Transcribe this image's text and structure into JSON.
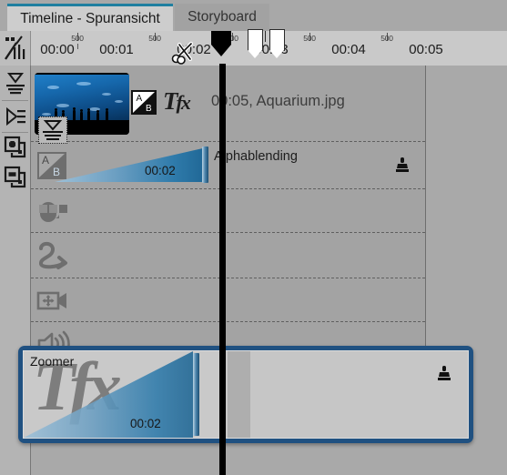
{
  "window": {
    "app_kind": "video-editing-timeline",
    "accent_color": "#1f7fa0",
    "selection_border_color": "#205181",
    "background_color": "#a9a9a9"
  },
  "tabs": [
    {
      "label": "Timeline - Spuransicht",
      "active": true
    },
    {
      "label": "Storyboard",
      "active": false
    }
  ],
  "ruler": {
    "icon": "timeline-scale-icon",
    "major_labels": [
      "00:00",
      "00:01",
      "00:02",
      "00:03",
      "00:04",
      "00:05"
    ],
    "minor_labels": [
      "500",
      "500",
      "500",
      "500",
      "500"
    ],
    "markers": [
      {
        "name": "in-marker",
        "position_label": "00:03"
      },
      {
        "name": "out-marker",
        "position_label": "00:03"
      }
    ],
    "playhead_time": "00:02"
  },
  "toolbar": {
    "buttons": [
      {
        "name": "align-down-button",
        "icon": "align-collapse-icon"
      },
      {
        "name": "align-right-button",
        "icon": "play-lines-icon"
      },
      {
        "name": "add-track-button",
        "icon": "plus-layers-icon"
      },
      {
        "name": "remove-track-button",
        "icon": "minus-layers-icon"
      }
    ]
  },
  "timeline": {
    "clip": {
      "thumbnail_alt": "Aquarium thumbnail",
      "transition_icon": "ab-transition-icon",
      "effects_icon": "tfx-icon",
      "duration": "00:05",
      "filename": "Aquarium.jpg",
      "label": "00:05, Aquarium.jpg",
      "badge_icon": "align-collapse-icon"
    },
    "tracks": [
      {
        "name": "track-alphablending",
        "icon": "ab-transition-icon",
        "label": "Alphablending",
        "duration": "00:02",
        "has_stamp": true
      },
      {
        "name": "track-transition",
        "icon": "transition-morph-icon",
        "label": "",
        "duration": "",
        "has_stamp": false
      },
      {
        "name": "track-motion-path",
        "icon": "curved-arrow-icon",
        "label": "",
        "duration": "",
        "has_stamp": false
      },
      {
        "name": "track-camera-pan",
        "icon": "camera-move-icon",
        "label": "",
        "duration": "",
        "has_stamp": false
      },
      {
        "name": "track-audio",
        "icon": "speaker-icon",
        "label": "",
        "duration": "",
        "has_stamp": false
      }
    ]
  },
  "zoomer_panel": {
    "title": "Zoomer",
    "watermark": "Tfx",
    "duration": "00:02",
    "stamp_icon": "stamp-icon",
    "selected": true
  },
  "cursor": {
    "icon": "scissors-cursor-icon"
  }
}
